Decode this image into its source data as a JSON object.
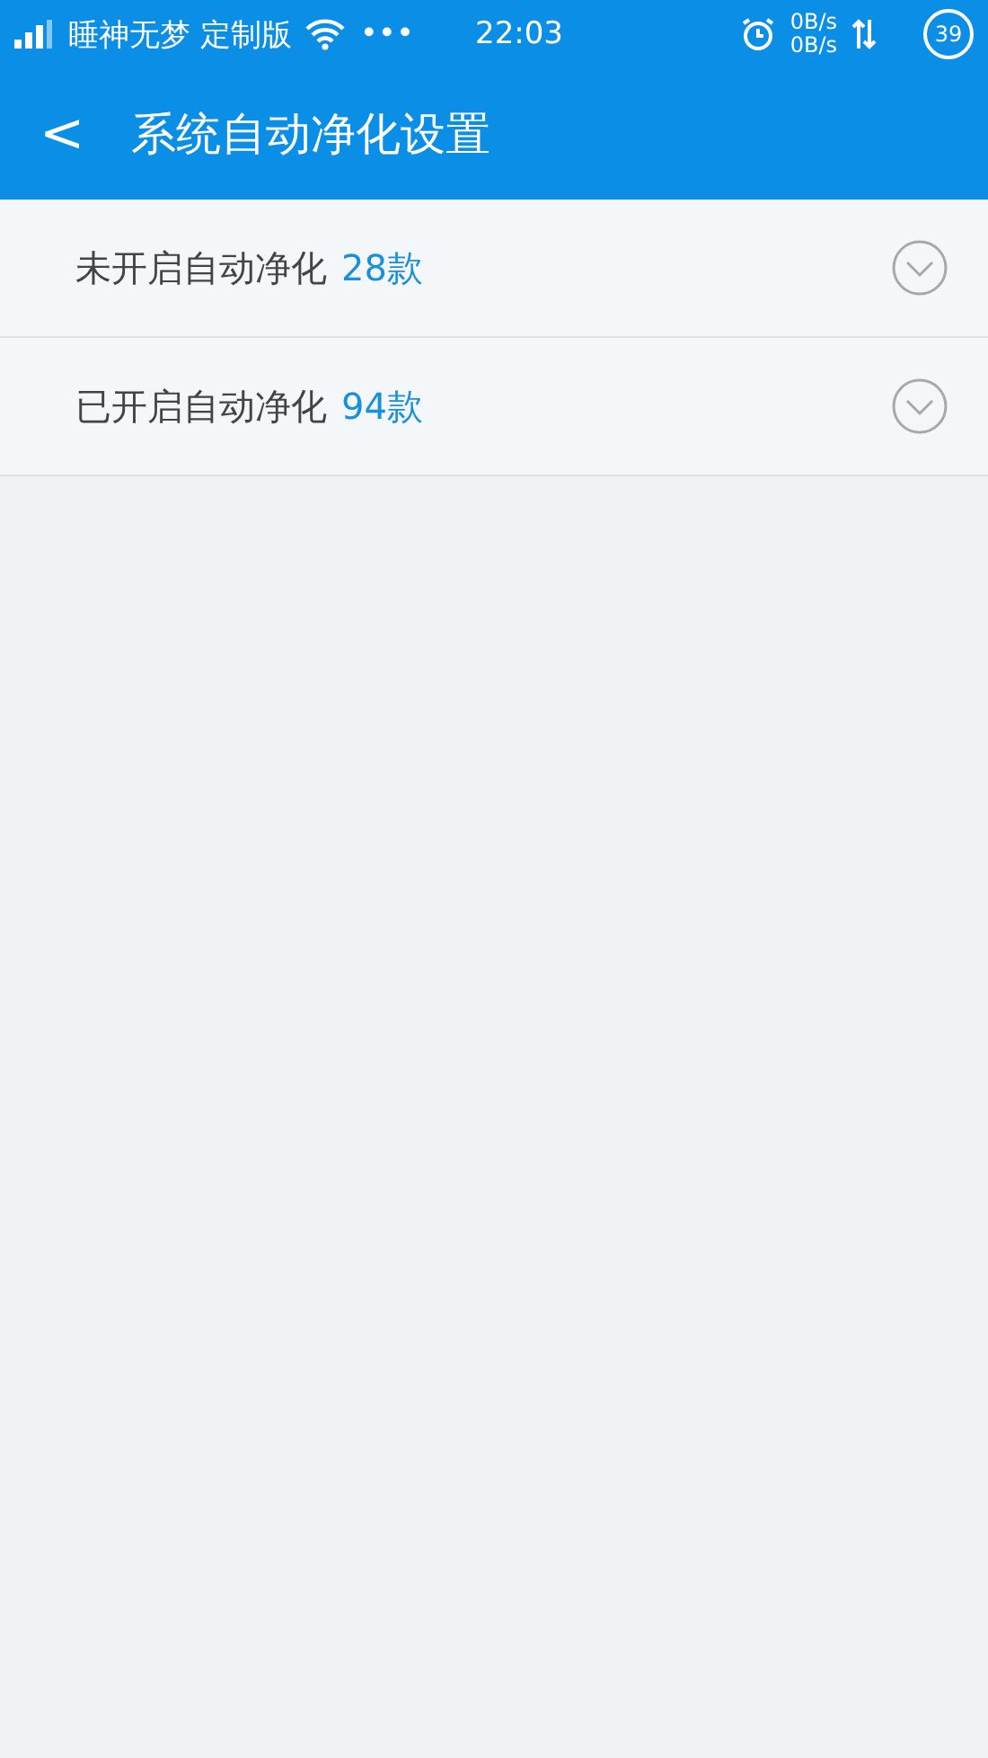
{
  "status_bar": {
    "carrier": "睡神无梦 定制版",
    "more": "•••",
    "time": "22:03",
    "upload_speed": "0B/s",
    "download_speed": "0B/s",
    "battery": "39"
  },
  "header": {
    "back": "<",
    "title": "系统自动净化设置"
  },
  "groups": [
    {
      "label": "未开启自动净化",
      "count": "28款",
      "expanded": false
    },
    {
      "label": "已开启自动净化",
      "count": "94款",
      "expanded": false
    }
  ]
}
